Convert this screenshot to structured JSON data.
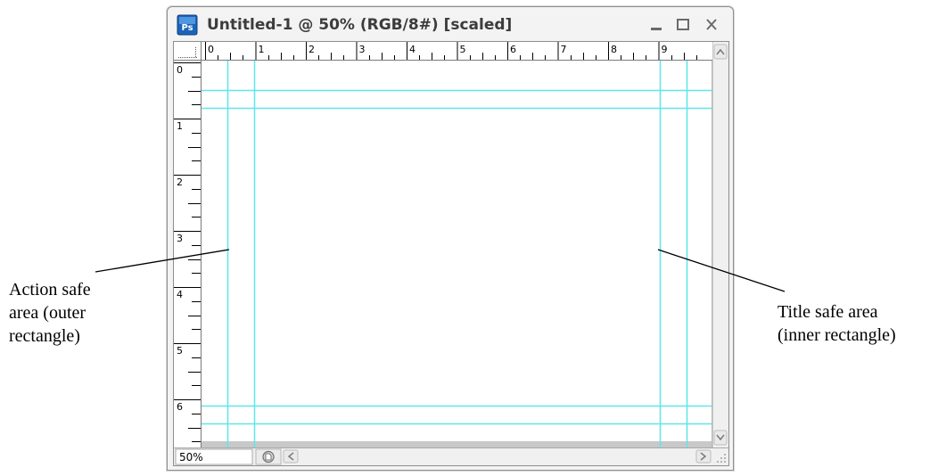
{
  "window": {
    "app_icon": "photoshop-icon",
    "title": "Untitled-1 @ 50% (RGB/8#) [scaled]",
    "controls": [
      "minimize-icon",
      "maximize-icon",
      "close-icon"
    ]
  },
  "rulers": {
    "horizontal_labels": [
      "0",
      "1",
      "2",
      "3",
      "4",
      "5",
      "6",
      "7",
      "8",
      "9"
    ],
    "vertical_labels": [
      "0",
      "1",
      "2",
      "3",
      "4",
      "5",
      "6"
    ]
  },
  "guides": {
    "color": "#5fe6ea"
  },
  "statusbar": {
    "zoom": "50%",
    "status_icon": "document-info-icon"
  },
  "scrollbars": {
    "up_icon": "scroll-up-icon",
    "down_icon": "scroll-down-icon",
    "left_icon": "scroll-left-icon",
    "right_icon": "scroll-right-icon",
    "grip_icon": "resize-grip-icon"
  },
  "annotations": {
    "action_safe": "Action safe\narea (outer\nrectangle)",
    "title_safe": "Title safe area\n(inner rectangle)"
  }
}
